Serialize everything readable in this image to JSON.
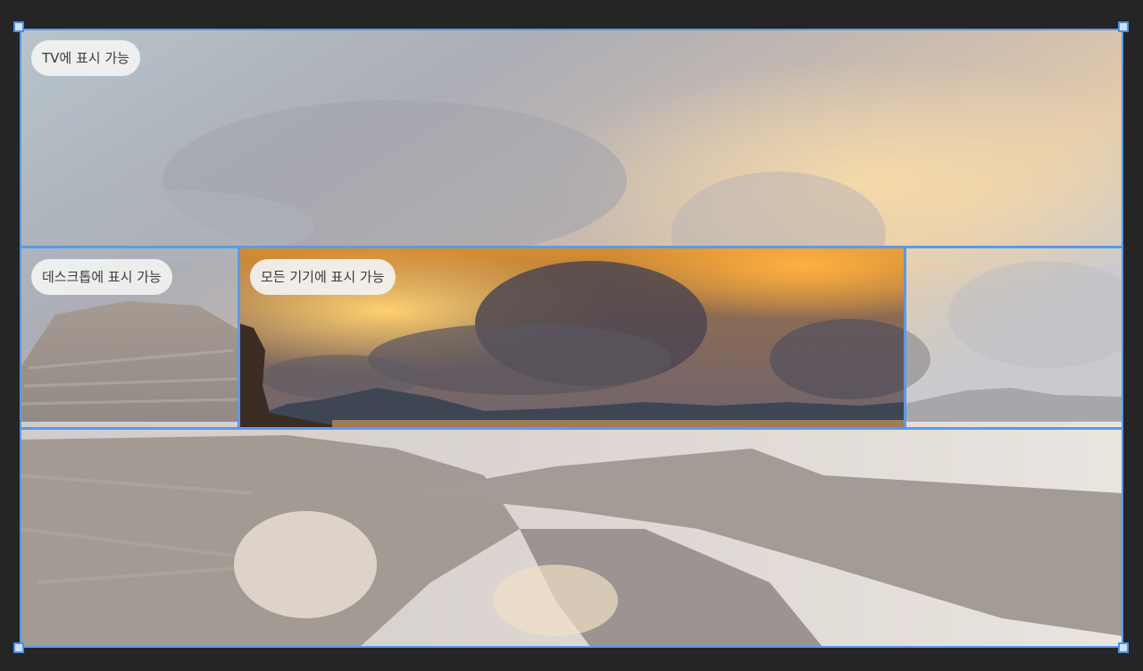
{
  "labels": {
    "tv": "TV에 표시 가능",
    "desktop": "데스크톱에 표시 가능",
    "all_devices": "모든 기기에 표시 가능"
  },
  "colors": {
    "guide_line": "#5a9ae6",
    "handle_border": "#4f8fe0",
    "background": "#252525"
  },
  "icons": {
    "crop_handles": [
      "crop-handle-top-left-icon",
      "crop-handle-top-right-icon",
      "crop-handle-bottom-left-icon",
      "crop-handle-bottom-right-icon"
    ]
  }
}
